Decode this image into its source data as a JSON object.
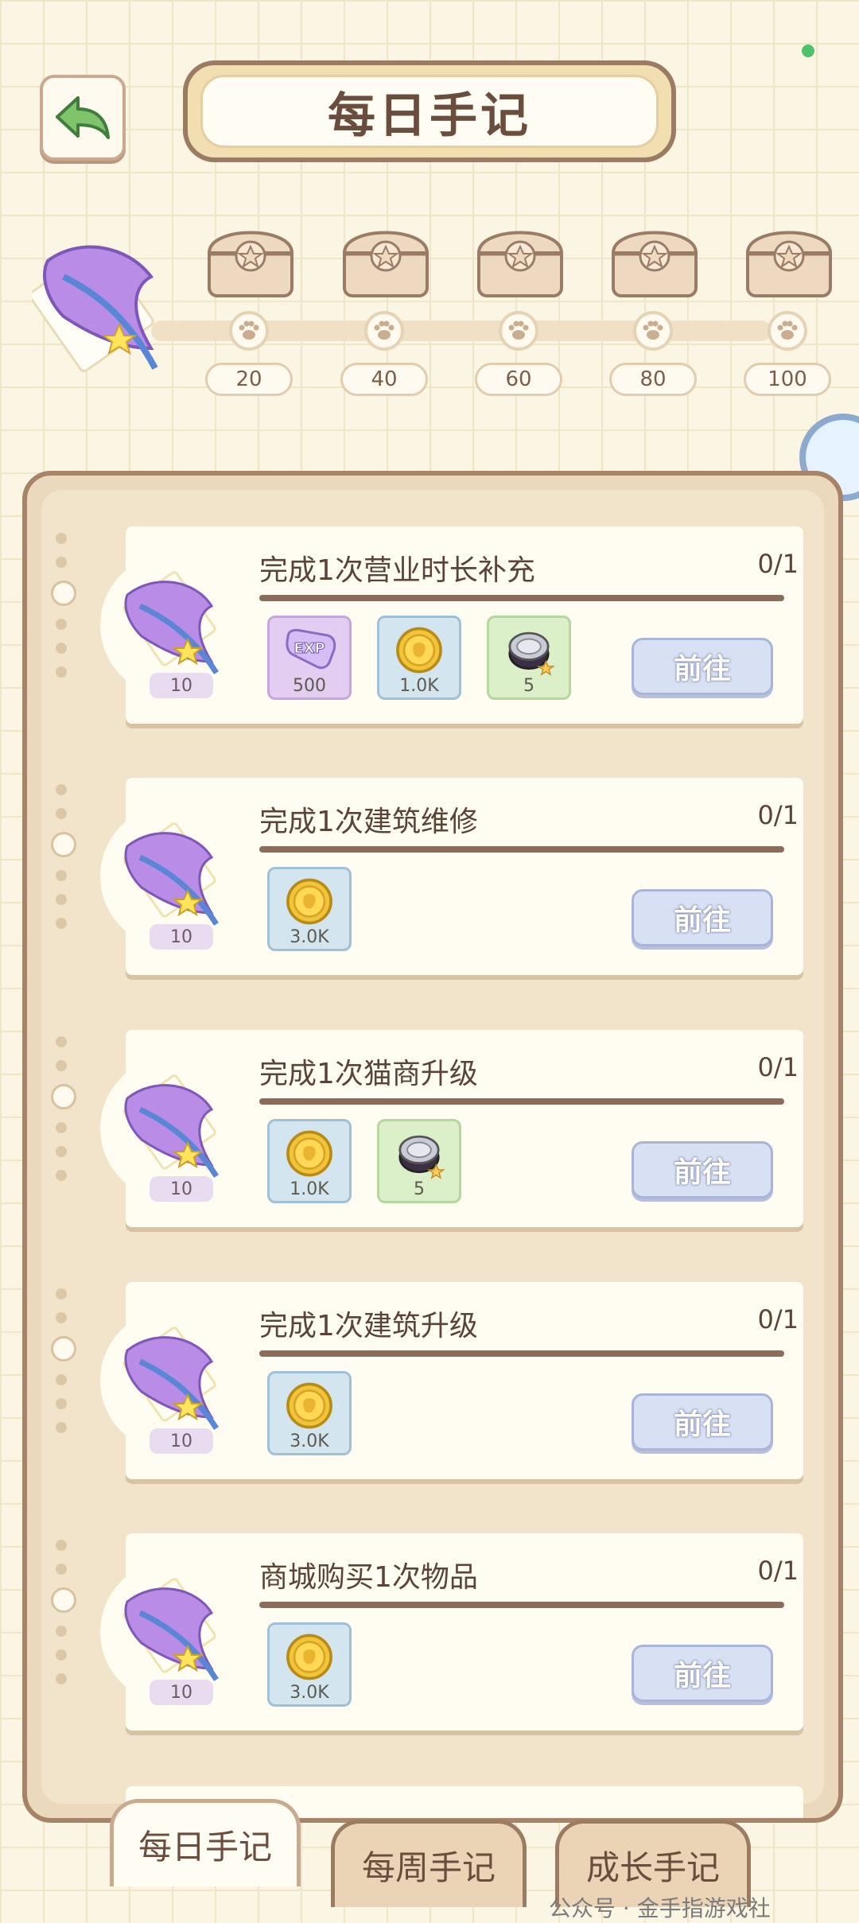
{
  "header": {
    "title": "每日手记"
  },
  "progress": {
    "milestones": [
      "20",
      "40",
      "60",
      "80",
      "100"
    ]
  },
  "tasks": [
    {
      "title": "完成1次营业时长补充",
      "count": "0/1",
      "points": "10",
      "rewards": [
        {
          "type": "exp",
          "amount": "500"
        },
        {
          "type": "coin",
          "amount": "1.0K"
        },
        {
          "type": "can",
          "amount": "5"
        }
      ],
      "button": "前往"
    },
    {
      "title": "完成1次建筑维修",
      "count": "0/1",
      "points": "10",
      "rewards": [
        {
          "type": "coin",
          "amount": "3.0K"
        }
      ],
      "button": "前往"
    },
    {
      "title": "完成1次猫商升级",
      "count": "0/1",
      "points": "10",
      "rewards": [
        {
          "type": "coin",
          "amount": "1.0K"
        },
        {
          "type": "can",
          "amount": "5"
        }
      ],
      "button": "前往"
    },
    {
      "title": "完成1次建筑升级",
      "count": "0/1",
      "points": "10",
      "rewards": [
        {
          "type": "coin",
          "amount": "3.0K"
        }
      ],
      "button": "前往"
    },
    {
      "title": "商城购买1次物品",
      "count": "0/1",
      "points": "10",
      "rewards": [
        {
          "type": "coin",
          "amount": "3.0K"
        }
      ],
      "button": "前往"
    }
  ],
  "tabs": [
    "每日手记",
    "每周手记",
    "成长手记"
  ],
  "watermark": "公众号 · 金手指游戏社",
  "colors": {
    "accent": "#8b6c5a",
    "button": "#d8e0f4",
    "background": "#fbf6e3"
  }
}
